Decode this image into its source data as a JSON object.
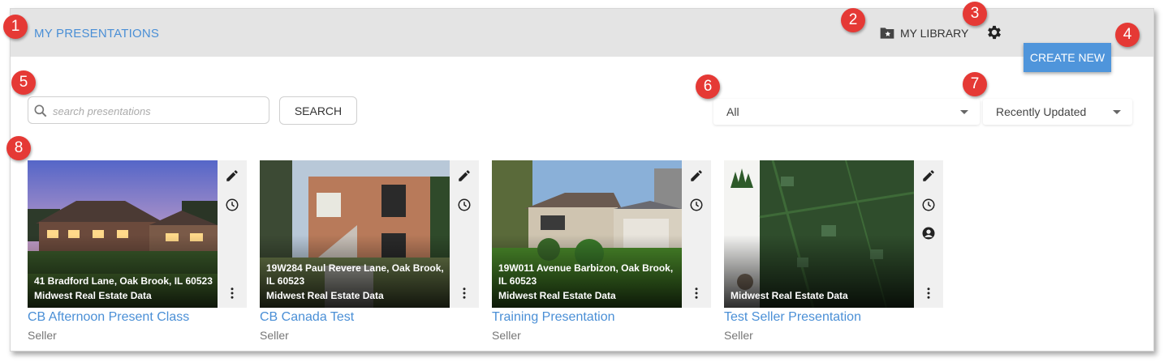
{
  "header": {
    "title": "MY PRESENTATIONS",
    "library_label": "MY LIBRARY",
    "library_icon": "folder-star-icon",
    "settings_icon": "gear-icon"
  },
  "toolbar": {
    "create_label": "CREATE NEW",
    "search_placeholder": "search presentations",
    "search_value": "",
    "search_button": "SEARCH",
    "filter_value": "All",
    "sort_value": "Recently Updated"
  },
  "colors": {
    "accent": "#4f95db",
    "link": "#4a8fd6",
    "callout": "#e53935"
  },
  "callouts": [
    "1",
    "2",
    "3",
    "4",
    "5",
    "6",
    "7",
    "8"
  ],
  "cards": [
    {
      "address": "41 Bradford Lane, Oak Brook, IL 60523",
      "org": "Midwest Real Estate Data",
      "title": "CB Afternoon Present Class",
      "type": "Seller"
    },
    {
      "address": "19W284 Paul Revere Lane, Oak Brook, IL 60523",
      "org": "Midwest Real Estate Data",
      "title": "CB Canada Test",
      "type": "Seller"
    },
    {
      "address": "19W011 Avenue Barbizon, Oak Brook, IL 60523",
      "org": "Midwest Real Estate Data",
      "title": "Training Presentation",
      "type": "Seller"
    },
    {
      "address": "",
      "org": "Midwest Real Estate Data",
      "title": "Test Seller Presentation",
      "type": "Seller"
    }
  ]
}
